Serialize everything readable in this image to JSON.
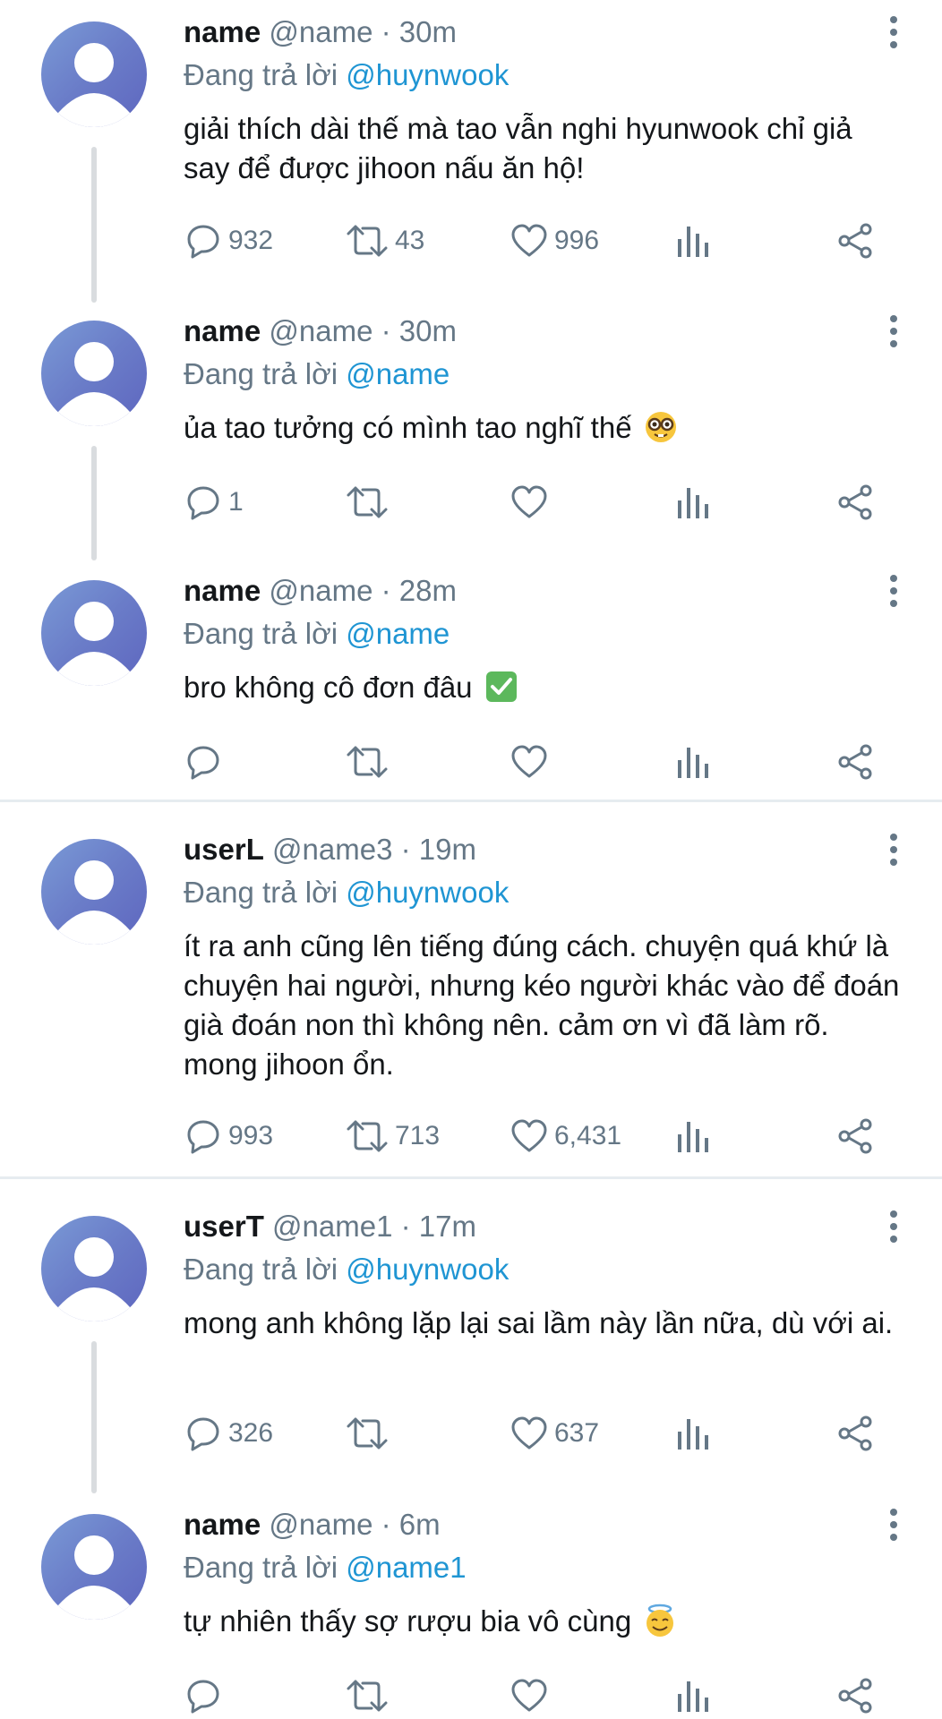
{
  "tweets": [
    {
      "name": "name",
      "handle": "@name",
      "time": "30m",
      "replying_label": "Đang trả lời",
      "mention": "@huynwook",
      "text": "giải thích dài thế mà tao vẫn nghi hyunwook chỉ giả say để được jihoon nấu ăn hộ!",
      "replies": "932",
      "retweets": "43",
      "likes": "996"
    },
    {
      "name": "name",
      "handle": "@name",
      "time": "30m",
      "replying_label": "Đang trả lời",
      "mention": "@name",
      "text": "ủa tao tưởng có mình tao nghĩ thế",
      "emoji": "nerd-face",
      "replies": "1",
      "retweets": "",
      "likes": ""
    },
    {
      "name": "name",
      "handle": "@name",
      "time": "28m",
      "replying_label": "Đang trả lời",
      "mention": "@name",
      "text": "bro không cô đơn đâu",
      "emoji": "check-mark-button",
      "replies": "",
      "retweets": "",
      "likes": ""
    },
    {
      "name": "userL",
      "handle": "@name3",
      "time": "19m",
      "replying_label": "Đang trả lời",
      "mention": "@huynwook",
      "text": "ít ra anh cũng lên tiếng đúng cách. chuyện quá khứ là chuyện hai người, nhưng kéo người khác vào để đoán già đoán non thì không nên. cảm ơn vì đã làm rõ. mong jihoon ổn.",
      "replies": "993",
      "retweets": "713",
      "likes": "6,431"
    },
    {
      "name": "userT",
      "handle": "@name1",
      "time": "17m",
      "replying_label": "Đang trả lời",
      "mention": "@huynwook",
      "text": "mong anh không lặp lại sai lầm này lần nữa, dù với ai.",
      "replies": "326",
      "retweets": "",
      "likes": "637"
    },
    {
      "name": "name",
      "handle": "@name",
      "time": "6m",
      "replying_label": "Đang trả lời",
      "mention": "@name1",
      "text": "tự nhiên thấy sợ rượu bia vô cùng",
      "emoji": "smiling-face-with-halo",
      "replies": "",
      "retweets": "",
      "likes": ""
    }
  ],
  "separator": "·",
  "colors": {
    "mention": "#1f95d3",
    "secondary_text": "#657786",
    "icon": "#657786",
    "thread_line": "#d9dcdf"
  }
}
